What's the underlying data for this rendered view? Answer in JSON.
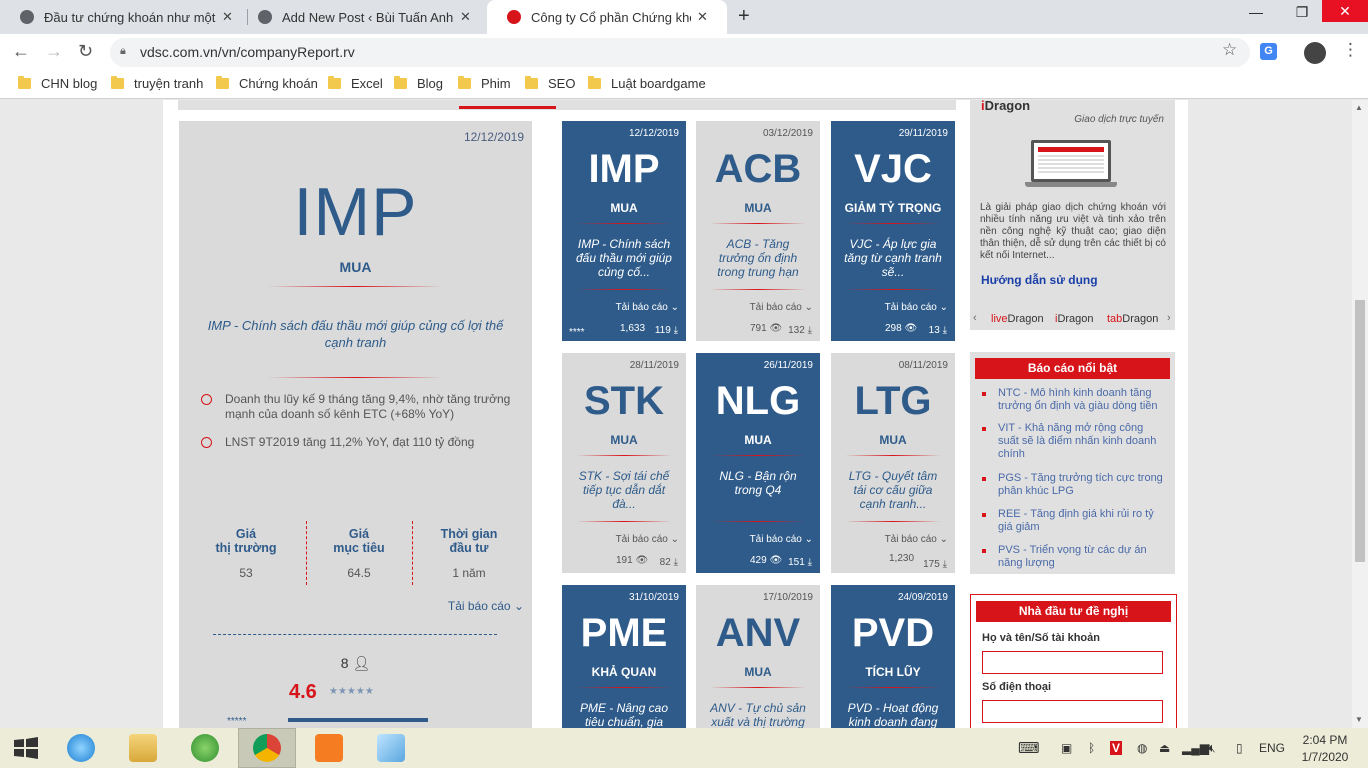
{
  "browser": {
    "tabs": [
      {
        "title": "Đầu tư chứng khoán như một kẻ"
      },
      {
        "title": "Add New Post ‹ Bùi Tuấn Anh —"
      },
      {
        "title": "Công ty Cổ phần Chứng khoán R"
      }
    ],
    "new_tab": "+",
    "url": "vdsc.com.vn/vn/companyReport.rv",
    "bookmarks": [
      "CHN blog",
      "truyện tranh",
      "Chứng khoán",
      "Excel",
      "Blog",
      "Phim",
      "SEO",
      "Luật boardgame"
    ]
  },
  "featured": {
    "date": "12/12/2019",
    "code": "IMP",
    "rec": "MUA",
    "title": "IMP - Chính sách đấu thầu mới giúp củng cố lợi thế cạnh tranh",
    "bullets": [
      "Doanh thu lũy kế 9 tháng tăng 9,4%, nhờ tăng trưởng mạnh của doanh số kênh ETC (+68% YoY)",
      "LNST 9T2019 tăng 11,2% YoY, đạt 110 tỷ đồng"
    ],
    "stats": [
      {
        "label1": "Giá",
        "label2": "thị trường",
        "value": "53"
      },
      {
        "label1": "Giá",
        "label2": "mục tiêu",
        "value": "64.5"
      },
      {
        "label1": "Thời gian",
        "label2": "đầu tư",
        "value": "1 năm"
      }
    ],
    "download": "Tải báo cáo",
    "users": "8",
    "score": "4.6",
    "stars": "★★★★★",
    "stars2": "*****"
  },
  "cards": [
    {
      "date": "12/12/2019",
      "code": "IMP",
      "rec": "MUA",
      "title": "IMP - Chính sách đấu thầu mới giúp củng cố...",
      "dl": "Tải báo cáo",
      "views": "1,633",
      "downloads": "119",
      "ast": "****",
      "theme": "blue"
    },
    {
      "date": "03/12/2019",
      "code": "ACB",
      "rec": "MUA",
      "title": "ACB - Tăng trưởng ổn định trong trung hạn",
      "dl": "Tải báo cáo",
      "views": "791",
      "downloads": "132",
      "ast": "",
      "theme": "grey"
    },
    {
      "date": "29/11/2019",
      "code": "VJC",
      "rec": "GIẢM TỶ TRỌNG",
      "title": "VJC - Áp lực gia tăng từ cạnh tranh sẽ...",
      "dl": "Tải báo cáo",
      "views": "298",
      "downloads": "13",
      "ast": "",
      "theme": "blue"
    },
    {
      "date": "28/11/2019",
      "code": "STK",
      "rec": "MUA",
      "title": "STK - Sợi tái chế tiếp tục dẫn dắt đà...",
      "dl": "Tải báo cáo",
      "views": "191",
      "downloads": "82",
      "ast": "",
      "theme": "grey"
    },
    {
      "date": "26/11/2019",
      "code": "NLG",
      "rec": "MUA",
      "title": "NLG - Bận rộn trong Q4",
      "dl": "Tải báo cáo",
      "views": "429",
      "downloads": "151",
      "ast": "",
      "theme": "blue"
    },
    {
      "date": "08/11/2019",
      "code": "LTG",
      "rec": "MUA",
      "title": "LTG - Quyết tâm tái cơ cấu giữa cạnh tranh...",
      "dl": "Tải báo cáo",
      "views": "1,230",
      "downloads": "175",
      "ast": "",
      "theme": "grey"
    },
    {
      "date": "31/10/2019",
      "code": "PME",
      "rec": "KHẢ QUAN",
      "title": "PME - Nâng cao tiêu chuẩn, gia tăng",
      "dl": "",
      "views": "",
      "downloads": "",
      "ast": "",
      "theme": "blue"
    },
    {
      "date": "17/10/2019",
      "code": "ANV",
      "rec": "MUA",
      "title": "ANV - Tự chủ sản xuất và thị trường",
      "dl": "",
      "views": "",
      "downloads": "",
      "ast": "",
      "theme": "grey"
    },
    {
      "date": "24/09/2019",
      "code": "PVD",
      "rec": "TÍCH LŨY",
      "title": "PVD - Hoạt động kinh doanh đang",
      "dl": "",
      "views": "",
      "downloads": "",
      "ast": "",
      "theme": "blue"
    }
  ],
  "idragon": {
    "title_i": "i",
    "title_rest": "Dragon",
    "subtitle": "Giao dịch trực tuyến",
    "desc": "Là giải pháp giao dịch chứng khoán với nhiều tính năng ưu việt và tinh xảo trên nền công nghệ kỹ thuật cao; giao diện thân thiện, dễ sử dụng trên các thiết bị có kết nối Internet...",
    "guide": "Hướng dẫn sử dụng",
    "dragons": [
      {
        "a": "live",
        "b": "Dragon"
      },
      {
        "a": "i",
        "b": "Dragon"
      },
      {
        "a": "tab",
        "b": "Dragon"
      }
    ]
  },
  "highlights": {
    "title": "Báo cáo nổi bật",
    "items": [
      "NTC - Mô hình kinh doanh tăng trưởng ổn định và giàu dòng tiền",
      "VIT - Khả năng mở rộng công suất sẽ là điểm nhấn kinh doanh chính",
      "PGS - Tăng trưởng tích cực trong phân khúc LPG",
      "REE - Tăng định giá khi rủi ro tỷ giá giảm",
      "PVS - Triển vọng từ các dự án năng lượng"
    ]
  },
  "investor": {
    "title": "Nhà đầu tư đề nghị",
    "label_name": "Họ và tên/Số tài khoản",
    "label_phone": "Số điện thoại"
  },
  "taskbar": {
    "lang": "ENG",
    "time": "2:04 PM",
    "date": "1/7/2020"
  },
  "colors": {
    "brand_blue": "#2e5b8a",
    "brand_red": "#d7141a",
    "card_grey": "#dadada"
  }
}
